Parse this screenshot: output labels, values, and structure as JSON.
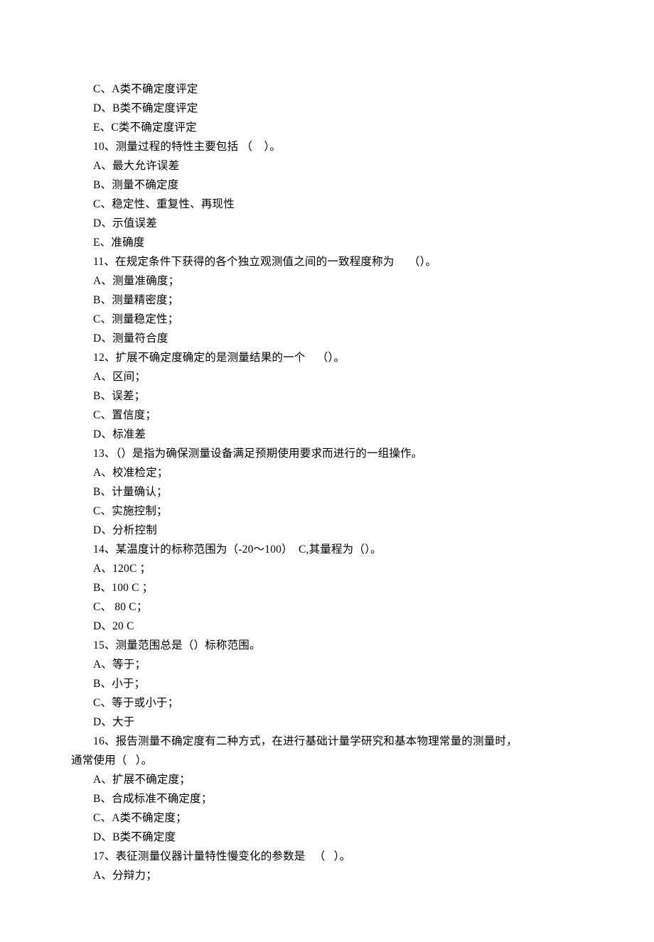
{
  "lines": [
    "C、A类不确定度评定",
    "D、B类不确定度评定",
    "E、C类不确定度评定",
    "10、测量过程的特性主要包括 （    ）。",
    "A、最大允许误差",
    "B、测量不确定度",
    "C、稳定性、重复性、再现性",
    "D、示值误差",
    "E、准确度",
    "11、在规定条件下获得的各个独立观测值之间的一致程度称为     （）。",
    "A、测量准确度；",
    "B、测量精密度；",
    "C、测量稳定性；",
    "D、测量符合度",
    "12、扩展不确定度确定的是测量结果的一个    （）。",
    "A、区间；",
    "B、误差；",
    "C、置信度；",
    "D、标准差",
    "13、（）是指为确保测量设备满足预期使用要求而进行的一组操作。",
    "A、校准检定；",
    "B、计量确认；",
    "C、实施控制；",
    "D、分析控制",
    "14、某温度计的标称范围为（-20～100）  C,其量程为（）。",
    "A、120C ；",
    "B、100 C ；",
    "C、 80 C；",
    "D、20 C",
    "15、测量范围总是（）标称范围。",
    "A、等于；",
    "B、小于；",
    "C、等于或小于；",
    "D、大于",
    "16、报告测量不确定度有二种方式，在进行基础计量学研究和基本物理常量的测量时，",
    "通常使用（   ）。",
    "A、扩展不确定度；",
    "B、合成标准不确定度；",
    "C、A类不确定度；",
    "D、B类不确定度",
    "17、表征测量仪器计量特性慢变化的参数是   （   ）。",
    "A、分辩力；"
  ],
  "noIndentIndices": [
    35
  ]
}
